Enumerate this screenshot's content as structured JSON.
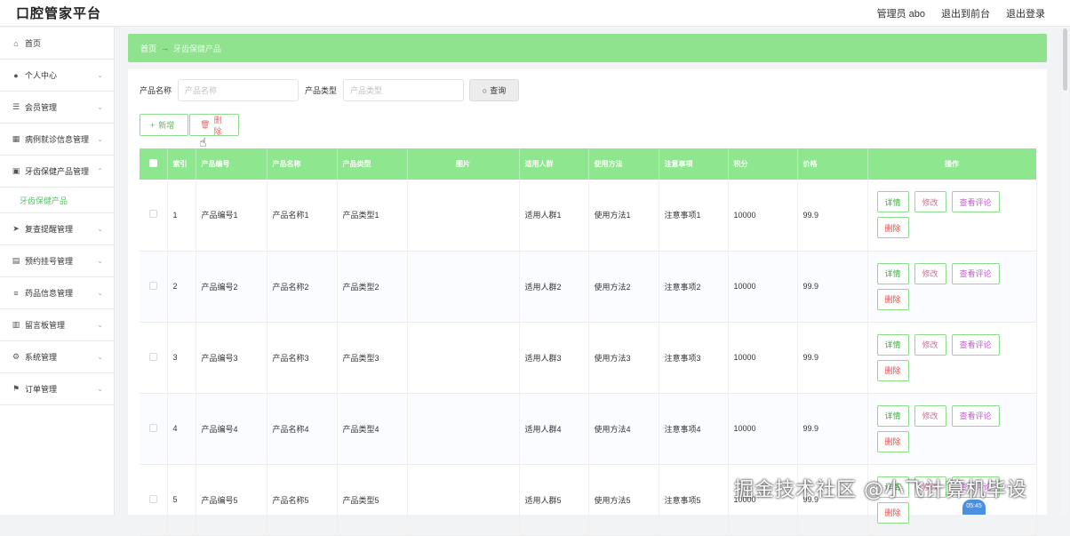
{
  "header": {
    "title": "口腔管家平台",
    "admin": "管理员 abo",
    "to_front": "退出到前台",
    "logout": "退出登录"
  },
  "sidebar": {
    "items": [
      {
        "label": "首页",
        "icon": "home-icon",
        "glyph": "⌂"
      },
      {
        "label": "个人中心",
        "icon": "user-icon",
        "glyph": "●"
      },
      {
        "label": "会员管理",
        "icon": "sliders-icon",
        "glyph": "☰"
      },
      {
        "label": "病例就诊信息管理",
        "icon": "grid-icon",
        "glyph": "▦"
      },
      {
        "label": "牙齿保健产品管理",
        "icon": "apps-icon",
        "glyph": "▣"
      },
      {
        "label": "复查提醒管理",
        "icon": "send-icon",
        "glyph": "➤"
      },
      {
        "label": "预约挂号管理",
        "icon": "calendar-icon",
        "glyph": "▤"
      },
      {
        "label": "药品信息管理",
        "icon": "list-icon",
        "glyph": "≡"
      },
      {
        "label": "留言板管理",
        "icon": "board-icon",
        "glyph": "▥"
      },
      {
        "label": "系统管理",
        "icon": "settings-icon",
        "glyph": "⚙"
      },
      {
        "label": "订单管理",
        "icon": "flag-icon",
        "glyph": "⚑"
      }
    ],
    "active_sub": "牙齿保健产品"
  },
  "breadcrumb": {
    "home": "首页",
    "current": "牙齿保健产品"
  },
  "search": {
    "name_label": "产品名称",
    "name_placeholder": "产品名称",
    "type_label": "产品类型",
    "type_placeholder": "产品类型",
    "button": "查询"
  },
  "actions": {
    "add": "新增",
    "delete": "删除"
  },
  "table": {
    "headers": [
      "索引",
      "产品编号",
      "产品名称",
      "产品类型",
      "图片",
      "适用人群",
      "使用方法",
      "注意事项",
      "积分",
      "价格",
      "操作"
    ],
    "ops": {
      "detail": "详情",
      "edit": "修改",
      "review": "查看评论",
      "delete": "删除"
    },
    "rows": [
      {
        "index": "1",
        "code": "产品编号1",
        "name": "产品名称1",
        "type": "产品类型1",
        "crowd": "适用人群1",
        "usage": "使用方法1",
        "note": "注意事项1",
        "points": "10000",
        "price": "99.9"
      },
      {
        "index": "2",
        "code": "产品编号2",
        "name": "产品名称2",
        "type": "产品类型2",
        "crowd": "适用人群2",
        "usage": "使用方法2",
        "note": "注意事项2",
        "points": "10000",
        "price": "99.9"
      },
      {
        "index": "3",
        "code": "产品编号3",
        "name": "产品名称3",
        "type": "产品类型3",
        "crowd": "适用人群3",
        "usage": "使用方法3",
        "note": "注意事项3",
        "points": "10000",
        "price": "99.9"
      },
      {
        "index": "4",
        "code": "产品编号4",
        "name": "产品名称4",
        "type": "产品类型4",
        "crowd": "适用人群4",
        "usage": "使用方法4",
        "note": "注意事项4",
        "points": "10000",
        "price": "99.9"
      },
      {
        "index": "5",
        "code": "产品编号5",
        "name": "产品名称5",
        "type": "产品类型5",
        "crowd": "适用人群5",
        "usage": "使用方法5",
        "note": "注意事项5",
        "points": "10000",
        "price": "99.9"
      }
    ]
  },
  "watermark": "掘金技术社区 @小飞计算机毕设",
  "badge": "05:45",
  "colors": {
    "accent": "#8ee68e",
    "breadcrumb_bg": "#8fe38f",
    "active_sub": "#5bc26a"
  }
}
